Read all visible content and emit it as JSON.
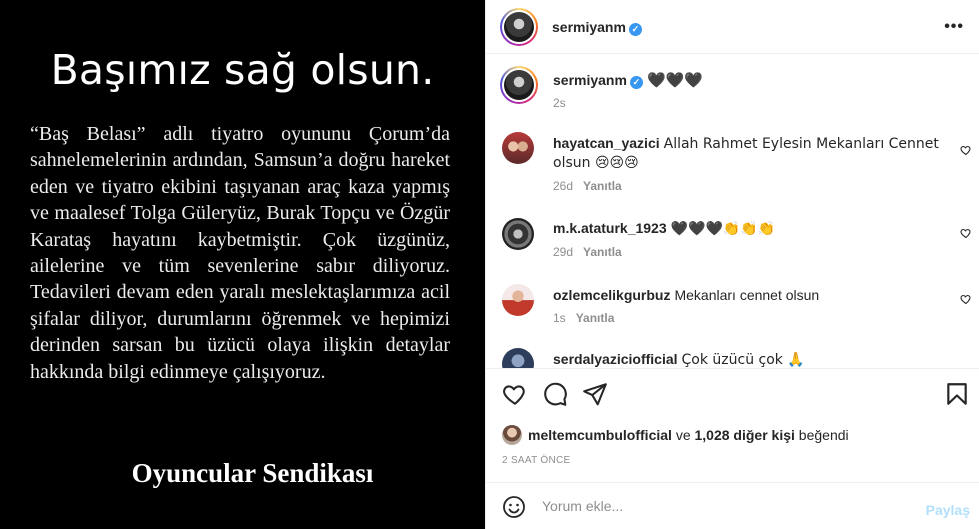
{
  "post_image": {
    "heading": "Başımız sağ olsun.",
    "body": "“Baş Belası” adlı tiyatro oyununu Çorum’da sahnelemelerinin ardından, Samsun’a doğru hareket eden ve tiyatro ekibini taşıyanan araç kaza yapmış ve maalesef Tolga Güleryüz, Burak Topçu ve Özgür Karataş hayatını kaybetmiştir. Çok üzgünüz, ailelerine ve tüm sevenlerine sabır diliyoruz. Tedavileri devam eden yaralı meslektaşlarımıza acil şifalar diliyor, durumlarını öğrenmek ve hepimizi derinden sarsan bu üzücü olaya ilişkin detaylar hakkında bilgi edinmeye çalışıyoruz.",
    "signature": "Oyuncular Sendikası"
  },
  "header": {
    "username": "sermiyanm",
    "verified_mark": "✓",
    "more_icon": "more-horizontal-icon",
    "more_glyph": "•••"
  },
  "caption": {
    "username": "sermiyanm",
    "verified_mark": "✓",
    "text": "🖤🖤🖤",
    "time": "2s"
  },
  "comments": [
    {
      "username": "hayatcan_yazici",
      "text": "Allah Rahmet Eylesin Mekanları Cennet olsun 😢😢😢",
      "time": "26d",
      "reply": "Yanıtla"
    },
    {
      "username": "m.k.ataturk_1923",
      "text": "🖤🖤🖤👏👏👏",
      "time": "29d",
      "reply": "Yanıtla"
    },
    {
      "username": "ozlemcelikgurbuz",
      "text": "Mekanları cennet olsun",
      "time": "1s",
      "reply": "Yanıtla"
    },
    {
      "username": "serdalyaziciofficial",
      "text": "Çok üzücü çok 🙏",
      "time": "",
      "reply": ""
    }
  ],
  "actions": {
    "icons": [
      "heart-icon",
      "comment-icon",
      "share-icon",
      "bookmark-icon"
    ]
  },
  "likes": {
    "liker": "meltemcumbulofficial",
    "connector": "ve",
    "others": "1,028 diğer kişi",
    "suffix": "beğendi"
  },
  "post_age": "2 SAAT ÖNCE",
  "add_comment": {
    "placeholder": "Yorum ekle...",
    "post_label": "Paylaş",
    "post_color": "#b2dffc"
  },
  "colors": {
    "verified": "#3897f0",
    "muted": "#8e8e8e",
    "text": "#262626"
  }
}
